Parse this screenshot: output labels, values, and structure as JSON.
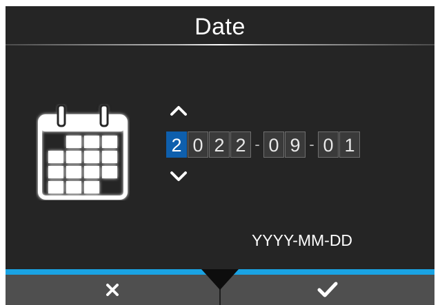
{
  "screen": {
    "title": "Date",
    "format_label": "YYYY-MM-DD"
  },
  "date_input": {
    "year_digits": [
      "2",
      "0",
      "2",
      "2"
    ],
    "month_digits": [
      "0",
      "9"
    ],
    "day_digits": [
      "0",
      "1"
    ],
    "separator": "-",
    "selected_field": "year",
    "selected_digit_index": 0
  },
  "icons": {
    "calendar": "calendar-icon",
    "up": "chevron-up-icon",
    "down": "chevron-down-icon",
    "cancel": "close-icon",
    "confirm": "checkmark-icon"
  },
  "colors": {
    "panel_background": "#252525",
    "selected_digit": "#0e5fad",
    "accent_bar": "#1aa3e3",
    "footer": "#4f4f4f"
  }
}
